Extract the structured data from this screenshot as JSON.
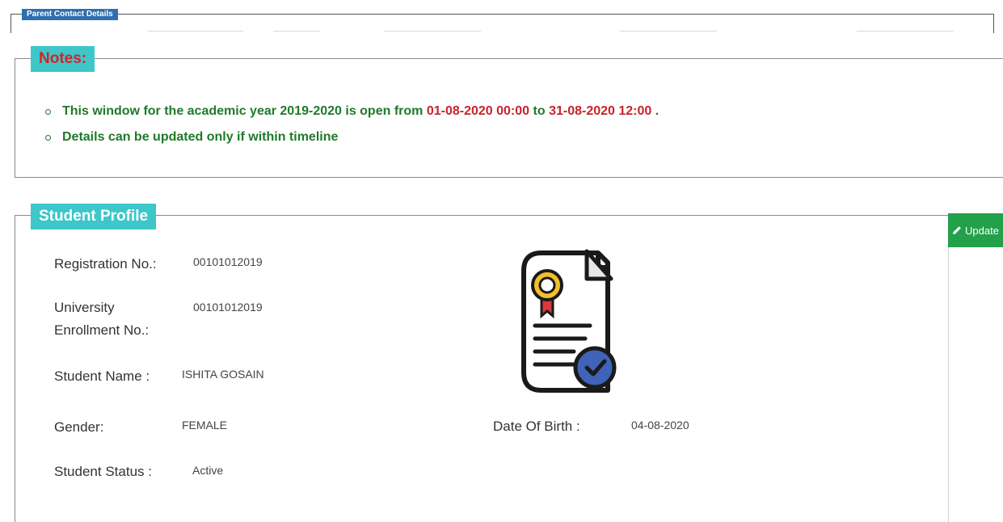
{
  "parent_contact": {
    "legend": "Parent Contact Details"
  },
  "notes": {
    "legend": "Notes:",
    "line1_prefix": "This window for the academic year 2019-2020 is open from",
    "open_from": "01-08-2020 00:00",
    "to_word": "to",
    "open_to": "31-08-2020 12:00",
    "line1_suffix": ".",
    "line2": "Details can be updated only if within timeline"
  },
  "profile": {
    "legend": "Student Profile",
    "update_label": "Update",
    "registration_label": "Registration No.:",
    "registration_value": "00101012019",
    "enrollment_label": "University Enrollment No.:",
    "enrollment_value": "00101012019",
    "name_label": "Student Name :",
    "name_value": "ISHITA GOSAIN",
    "gender_label": "Gender:",
    "gender_value": "FEMALE",
    "dob_label": "Date Of Birth :",
    "dob_value": "04-08-2020",
    "status_label": "Student Status :",
    "status_value": "Active"
  },
  "colors": {
    "legend_bg": "#3ec6c9",
    "notes_title": "#d8202a",
    "notes_text": "#1f7a2a",
    "date_red": "#c8232b",
    "update_bg": "#22a04a",
    "parent_legend_bg": "#2e6fb0"
  },
  "icons": {
    "update": "pencil-icon",
    "profile_image": "certificate-document-icon"
  }
}
